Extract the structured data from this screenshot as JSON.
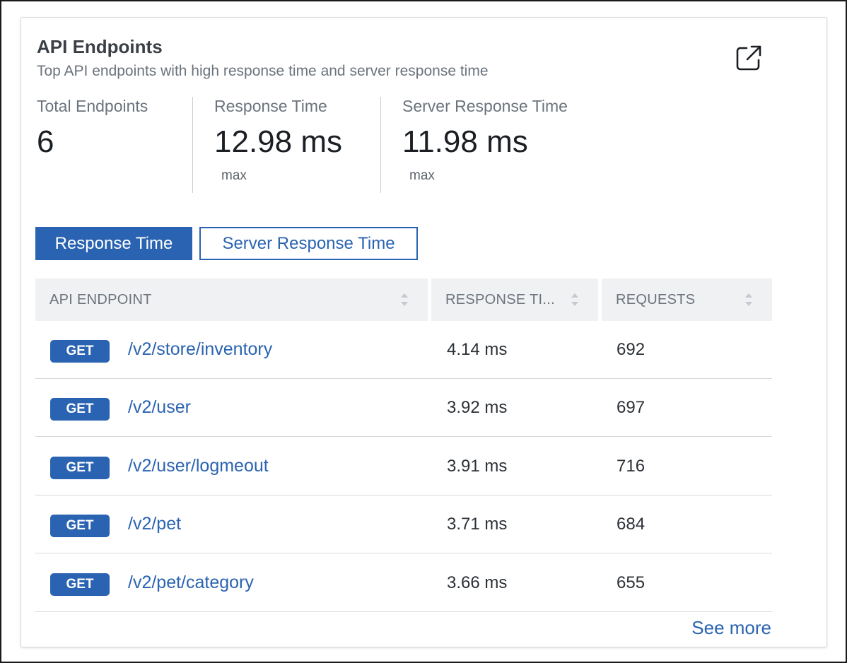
{
  "card": {
    "title": "API Endpoints",
    "subtitle": "Top API endpoints with high response time and server response time",
    "open_icon": "external-link-icon"
  },
  "stats": [
    {
      "label": "Total Endpoints",
      "value": "6",
      "sub": ""
    },
    {
      "label": "Response Time",
      "value": "12.98 ms",
      "sub": "max"
    },
    {
      "label": "Server Response Time",
      "value": "11.98 ms",
      "sub": "max"
    }
  ],
  "tabs": [
    {
      "label": "Response Time",
      "active": true
    },
    {
      "label": "Server Response Time",
      "active": false
    }
  ],
  "table": {
    "headers": [
      "API ENDPOINT",
      "RESPONSE TI...",
      "REQUESTS"
    ],
    "rows": [
      {
        "method": "GET",
        "path": "/v2/store/inventory",
        "response_time": "4.14 ms",
        "requests": "692"
      },
      {
        "method": "GET",
        "path": "/v2/user",
        "response_time": "3.92 ms",
        "requests": "697"
      },
      {
        "method": "GET",
        "path": "/v2/user/logmeout",
        "response_time": "3.91 ms",
        "requests": "716"
      },
      {
        "method": "GET",
        "path": "/v2/pet",
        "response_time": "3.71 ms",
        "requests": "684"
      },
      {
        "method": "GET",
        "path": "/v2/pet/category",
        "response_time": "3.66 ms",
        "requests": "655"
      }
    ]
  },
  "see_more_label": "See more",
  "colors": {
    "accent": "#2a63b1",
    "header_bg": "#f0f1f2"
  }
}
